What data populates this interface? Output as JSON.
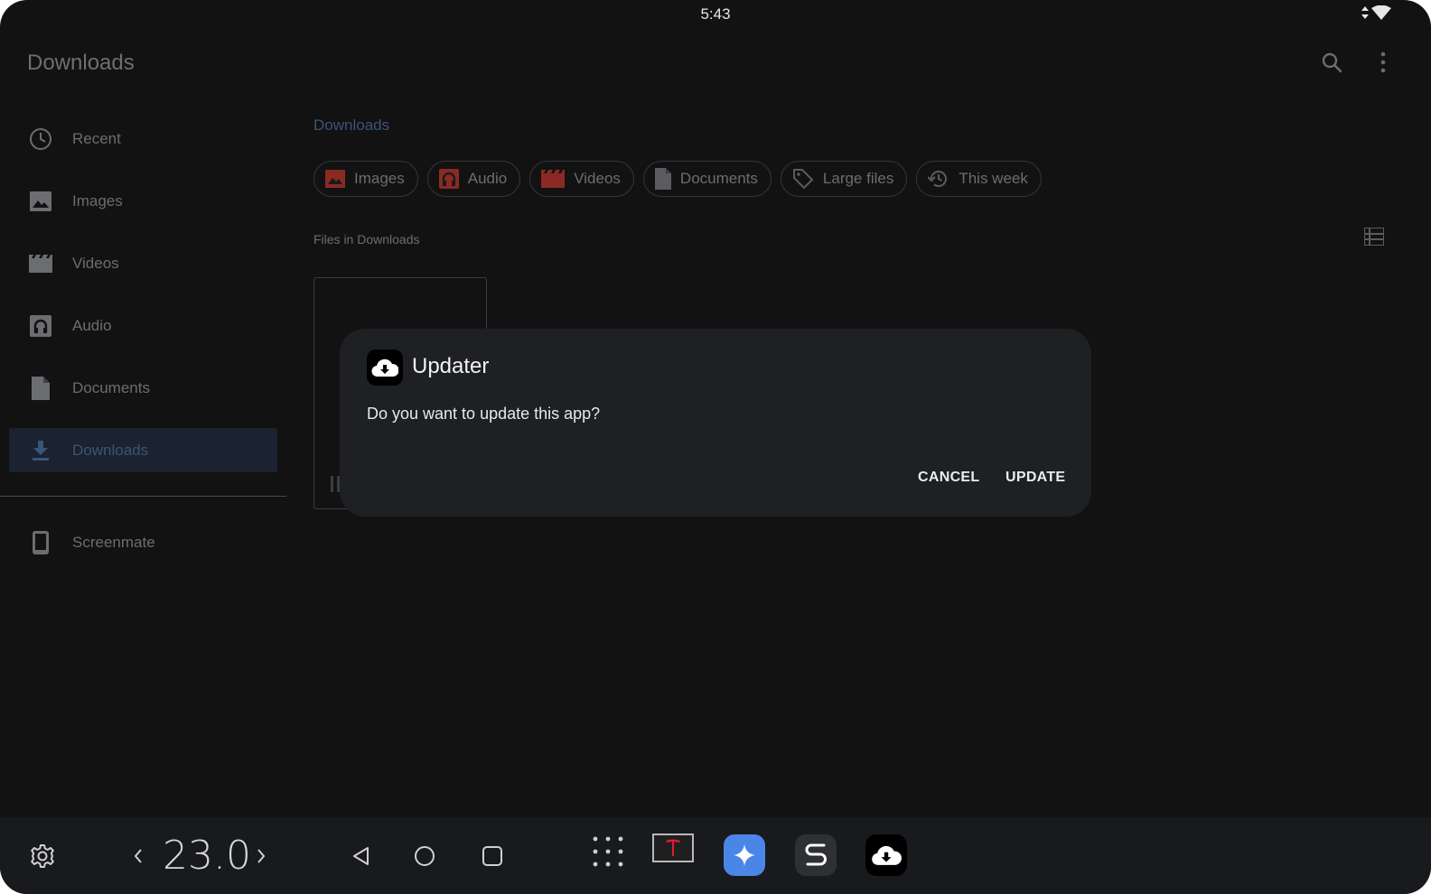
{
  "status_bar": {
    "time": "5:43"
  },
  "app_bar": {
    "title": "Downloads",
    "actions": [
      "search-icon",
      "more-vert-icon"
    ]
  },
  "sidebar": {
    "items": [
      {
        "label": "Recent",
        "icon": "clock-icon",
        "active": false
      },
      {
        "label": "Images",
        "icon": "image-icon",
        "active": false
      },
      {
        "label": "Videos",
        "icon": "video-icon",
        "active": false
      },
      {
        "label": "Audio",
        "icon": "headphones-icon",
        "active": false
      },
      {
        "label": "Documents",
        "icon": "document-icon",
        "active": false
      },
      {
        "label": "Downloads",
        "icon": "download-icon",
        "active": true
      }
    ],
    "devices": [
      {
        "label": "Screenmate",
        "icon": "phone-icon"
      }
    ]
  },
  "content": {
    "breadcrumb": "Downloads",
    "chips": [
      {
        "label": "Images",
        "icon": "image-icon"
      },
      {
        "label": "Audio",
        "icon": "headphones-icon"
      },
      {
        "label": "Videos",
        "icon": "video-icon"
      },
      {
        "label": "Documents",
        "icon": "document-icon"
      },
      {
        "label": "Large files",
        "icon": "tag-icon"
      },
      {
        "label": "This week",
        "icon": "history-icon"
      }
    ],
    "section_label": "Files in Downloads"
  },
  "dialog": {
    "title": "Updater",
    "message": "Do you want to update this app?",
    "cancel_label": "CANCEL",
    "confirm_label": "UPDATE"
  },
  "taskbar": {
    "temperature": "23.0",
    "apps": [
      "app-grid-icon",
      "tesla-app-icon",
      "assistant-app-icon",
      "s-app-icon",
      "updater-app-icon"
    ]
  },
  "colors": {
    "background": "#121212",
    "dialog": "#1e2023",
    "accent": "#3b5479",
    "chip_icon_red": "#8b2a24",
    "assistant_blue": "#4a86e8",
    "tesla_red": "#e31937"
  }
}
